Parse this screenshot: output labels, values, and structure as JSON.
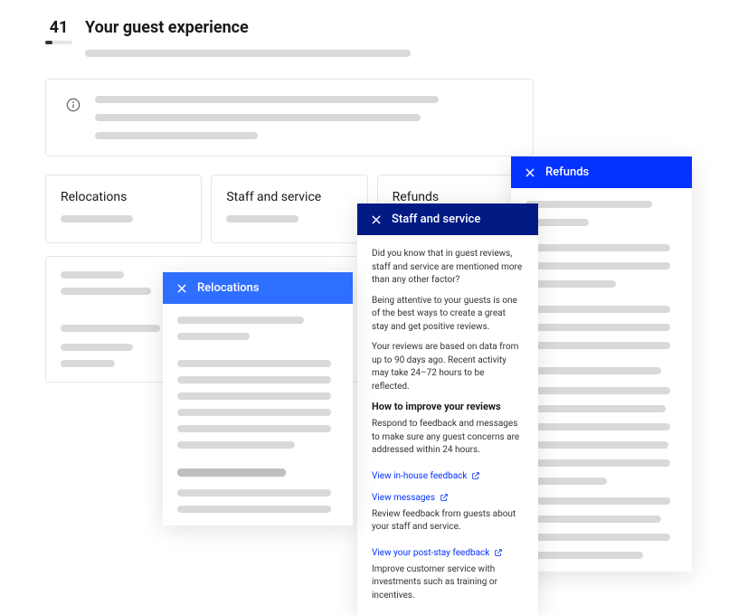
{
  "header": {
    "score": "41",
    "title": "Your guest experience"
  },
  "tiles": {
    "relocations": "Relocations",
    "staff": "Staff and service",
    "refunds": "Refunds"
  },
  "overlays": {
    "refunds": {
      "title": "Refunds"
    },
    "staff": {
      "title": "Staff and service",
      "p1": "Did you know that in guest reviews, staff and service are mentioned more than any other factor?",
      "p2": "Being attentive to your guests is one of the best ways to create a great stay and get positive reviews.",
      "p3": "Your reviews are based on data from up to 90 days ago. Recent activity may take 24–72 hours to be reflected.",
      "improve_title": "How to improve your reviews",
      "p4": "Respond to feedback and messages to make sure any guest concerns are addressed within 24 hours.",
      "link1": "View in-house feedback",
      "link2": "View messages",
      "p5": "Review feedback from guests about your staff and service.",
      "link3": "View your post-stay feedback",
      "p6": "Improve customer service with investments such as training or incentives."
    },
    "relocations": {
      "title": "Relocations"
    }
  }
}
